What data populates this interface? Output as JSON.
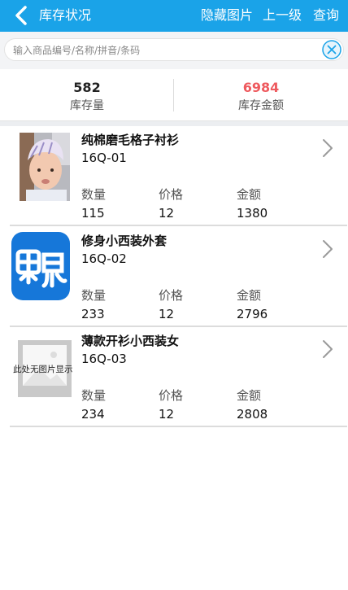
{
  "header": {
    "title": "库存状况",
    "actions": [
      "隐藏图片",
      "上一级",
      "查询"
    ]
  },
  "search": {
    "placeholder": "输入商品编号/名称/拼音/条码",
    "value": ""
  },
  "summary": {
    "quantity_value": "582",
    "quantity_label": "库存量",
    "amount_value": "6984",
    "amount_label": "库存金额",
    "amount_color": "#ee5a5e"
  },
  "field_labels": {
    "qty": "数量",
    "price": "价格",
    "amount": "金额"
  },
  "products": [
    {
      "name": "纯棉磨毛格子衬衫",
      "code": "16Q-01",
      "qty": "115",
      "price": "12",
      "amount": "1380",
      "image": "baby-photo"
    },
    {
      "name": "修身小西装外套",
      "code": "16Q-02",
      "qty": "233",
      "price": "12",
      "amount": "2796",
      "image": "app-logo"
    },
    {
      "name": "薄款开衫小西装女",
      "code": "16Q-03",
      "qty": "234",
      "price": "12",
      "amount": "2808",
      "image": "no-image",
      "no_image_text": "此处无图片显示"
    }
  ],
  "colors": {
    "header_bg": "#1aa3e8",
    "accent": "#1aa3e8",
    "amount_red": "#ee5a5e"
  }
}
